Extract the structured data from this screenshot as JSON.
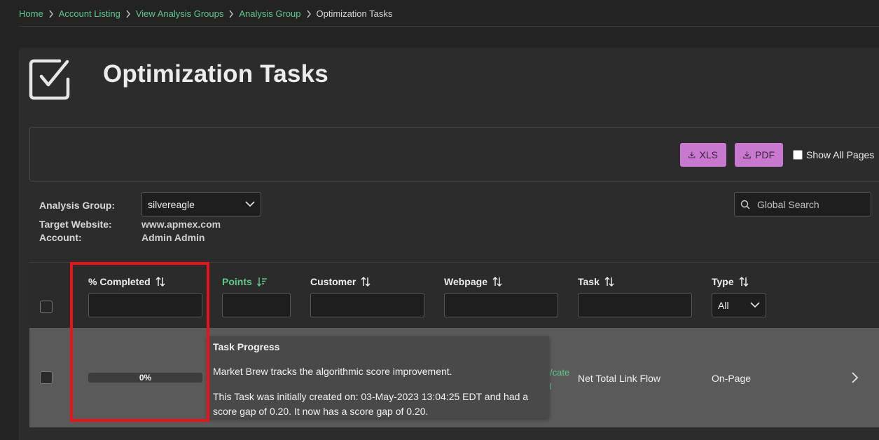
{
  "breadcrumb": {
    "items": [
      "Home",
      "Account Listing",
      "View Analysis Groups",
      "Analysis Group"
    ],
    "current": "Optimization Tasks"
  },
  "page": {
    "title": "Optimization Tasks"
  },
  "toolbar": {
    "xls_label": "XLS",
    "pdf_label": "PDF",
    "show_all_pages_label": "Show All Pages",
    "show_all_pages_checked": false
  },
  "info": {
    "analysis_group_label": "Analysis Group:",
    "analysis_group_value": "silvereagle",
    "target_website_label": "Target Website:",
    "target_website_value": "www.apmex.com",
    "account_label": "Account:",
    "account_value": "Admin Admin"
  },
  "search": {
    "placeholder": "Global Search"
  },
  "table": {
    "columns": [
      {
        "label": "% Completed",
        "sort": "none"
      },
      {
        "label": "Points",
        "sort": "descending"
      },
      {
        "label": "Customer",
        "sort": "none"
      },
      {
        "label": "Webpage",
        "sort": "none"
      },
      {
        "label": "Task",
        "sort": "none"
      },
      {
        "label": "Type",
        "sort": "none"
      }
    ],
    "type_filter_value": "All",
    "rows": [
      {
        "percent_completed": "0%",
        "progress_fraction": 0,
        "webpage_fragment": "/cate",
        "webpage_fragment2": "l",
        "task": "Net Total Link Flow",
        "type": "On-Page"
      }
    ]
  },
  "tooltip": {
    "title": "Task Progress",
    "line1": "Market Brew tracks the algorithmic score improvement.",
    "line2": "This Task was initially created on: 03-May-2023 13:04:25 EDT and had a score gap of 0.20. It now has a score gap of 0.20."
  },
  "colors": {
    "accent_green": "#5fc98a",
    "export_button": "#c879cf",
    "highlight_red": "#e8141b"
  }
}
